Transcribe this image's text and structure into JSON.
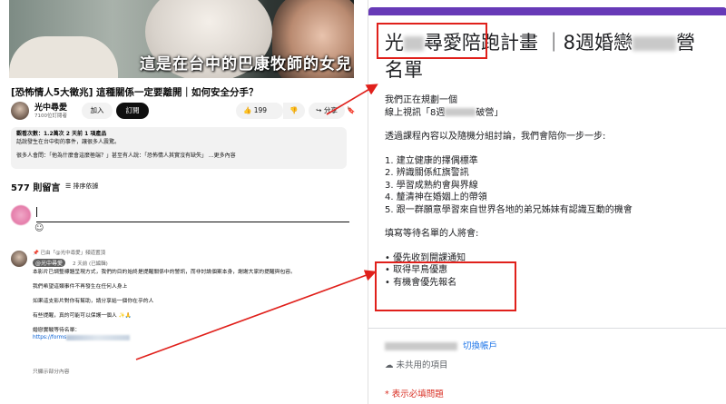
{
  "video": {
    "caption": "這是在台中的巴康牧師的女兒",
    "title": "[恐怖情人5大徵兆] 這種關係一定要離開｜如何安全分手？"
  },
  "channel": {
    "name": "光中尋愛",
    "subs": "7100位訂閱者",
    "join_label": "加入",
    "subscribe_label": "訂閱",
    "likes": "199",
    "share_label": "分享"
  },
  "description": {
    "line1": "觀看次數：1.2萬次  2 天前  1 項產品",
    "line2": "話說發生在台中街的事件，讓很多人震驚。",
    "line3": "很多人會問：「他為什麼會這麼極端？」甚至有人說：「恐怖情人其實沒有缺失」 ...更多內容"
  },
  "comments": {
    "count_label": "577 則留言",
    "sort_label": "排序依據",
    "emoji": "☺",
    "pinned_label": "已由「@光中尋愛」頻道置頂",
    "author": "@光中尋愛",
    "time": "2 天前 (已編輯)",
    "body": [
      "本影片已調整標題呈現方式，我們的目的始終是提醒關係中的警訊，而非討論個案本身，謝謝大家的提醒與包容。",
      "我們希望這類事件不再發生在任何人身上",
      "如果這支影片對你有幫助，請分享給一個你在乎的人",
      "有些提醒，真的可能可以保護一個人 ✨🙏",
      "婚戀實戰等待名單：",
      "https://forms"
    ],
    "more_label": "只顯示部分內容"
  },
  "form": {
    "title_a": "光",
    "title_b": "尋愛陪跑計畫 ｜8週婚戀",
    "title_c": "營",
    "title_line2": "名單",
    "intro1": "我們正在規劃一個",
    "intro2a": "線上視訊「8週",
    "intro2b": "破營」",
    "lead": "透過課程內容以及隨機分組討論，我們會陪你一步一步:",
    "steps": [
      "1. 建立健康的擇偶標準",
      "2. 辨識關係紅旗警訊",
      "3. 學習成熟約會與界線",
      "4. 釐清神在婚姻上的帶領",
      "5. 跟一群願意學習來自世界各地的弟兄姊妹有認識互動的機會"
    ],
    "waitlist_label": "填寫等待名單的人將會:",
    "benefits": [
      "• 優先收到開課通知",
      "• 取得早鳥優惠",
      "• 有機會優先報名"
    ],
    "switch_account": "切換帳戶",
    "not_shared": "未共用的項目",
    "required_note": "* 表示必填問題"
  },
  "colors": {
    "accent_red": "#e0201b",
    "form_purple": "#673ab7",
    "link_blue": "#1a73e8"
  }
}
